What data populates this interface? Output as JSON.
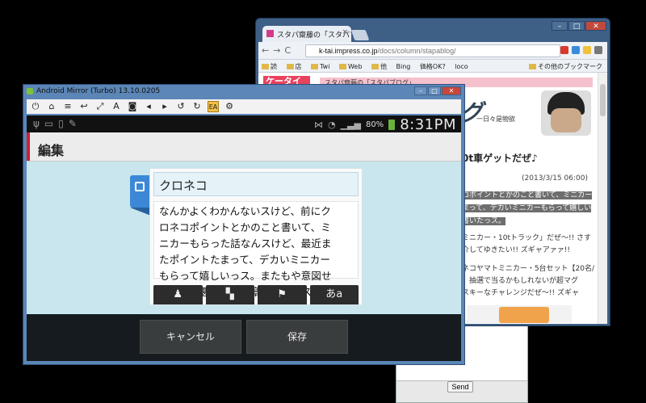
{
  "browser": {
    "tab_title": "スタパ齋藤の「スタパブロ",
    "url_host": "k-tai.impress.co.jp",
    "url_path": "/docs/column/stapablog/",
    "bookmarks": [
      "読",
      "店",
      "Twi",
      "Web",
      "他",
      "Bing",
      "価格OK?",
      "loco"
    ],
    "other_bookmarks": "その他のブックマーク",
    "logo_text": "ケータイ",
    "section_bar": "スタパ齋藤の「スタパブログ」",
    "banner_word": "グ",
    "banner_sub": "一日々是物欲",
    "article_title": "0t車ゲットだぜ♪",
    "article_date": "(2013/3/15 06:00)",
    "highlight_lines": [
      "コポイントとかのこと書いて、ミニカー",
      "まって、デカいミニカーもらって嬉しい",
      "書いたっス。"
    ],
    "paragraph1": [
      "ミニカー・10tトラック」だぜ〜!! さす",
      "介してゆきたい!! ズギャアァァ!!"
    ],
    "paragraph2": [
      "ネコヤマトミニカー・5台セット【20名/",
      "、抽選で当るかもしれないが超マグ",
      "スキーなチャレンジだぜ〜!! ズギャ"
    ],
    "send_label": "Send"
  },
  "mirror": {
    "window_title": "Android Mirror (Turbo) 13.10.0205",
    "status": {
      "battery": "80%",
      "time": "8:31PM"
    },
    "header_title": "編集",
    "name_value": "クロネコ",
    "body_lines": [
      "なんかよくわかんないスけど、前にク",
      "ロネコポイントとかのこと書いて、ミ",
      "ニカーもらった話なんスけど、最近ま",
      "たポイントたまって、デカいミニカー",
      "もらって嬉しいっス。またもや意図せ",
      "ずアタマ悪そうな文章書いたっス。"
    ],
    "keyboard_last": "あa",
    "cancel_label": "キャンセル",
    "save_label": "保存"
  }
}
